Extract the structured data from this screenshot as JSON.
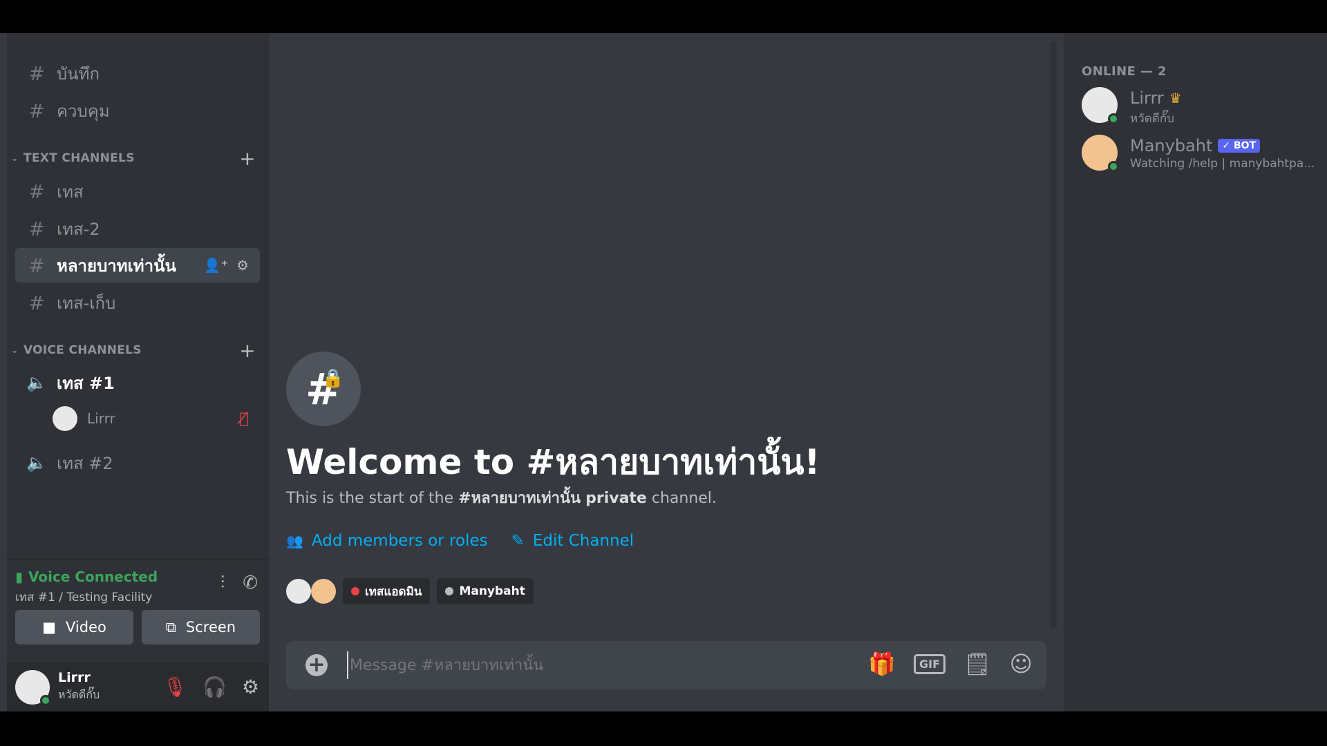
{
  "sidebar": {
    "top_channels": [
      {
        "name": "บันทึก"
      },
      {
        "name": "ควบคุม"
      }
    ],
    "text_category": "TEXT CHANNELS",
    "text_channels": [
      {
        "name": "เทส"
      },
      {
        "name": "เทส-2"
      },
      {
        "name": "หลายบาทเท่านั้น"
      },
      {
        "name": "เทส-เก็บ"
      }
    ],
    "voice_category": "VOICE CHANNELS",
    "voice_channels": [
      {
        "name": "เทส #1"
      },
      {
        "name": "เทส #2"
      }
    ],
    "voice_users": [
      {
        "name": "Lirrr"
      }
    ]
  },
  "voice_panel": {
    "status": "Voice Connected",
    "location": "เทส #1 / Testing Facility",
    "video_label": "Video",
    "screen_label": "Screen"
  },
  "user": {
    "name": "Lirrr",
    "status": "หวัดดีกั๊บ"
  },
  "main": {
    "welcome_title": "Welcome to #หลายบาทเท่านั้น!",
    "desc_prefix": "This is the start of the ",
    "desc_channel": "#หลายบาทเท่านั้น",
    "desc_private": "private",
    "desc_suffix": " channel.",
    "add_members": "Add members or roles",
    "edit_channel": "Edit Channel",
    "roles": [
      {
        "name": "เทสแอดมิน",
        "color": "#ed4245"
      },
      {
        "name": "Manybaht",
        "color": "#b9bbbe"
      }
    ],
    "composer_placeholder": "Message #หลายบาทเท่านั้น"
  },
  "members": {
    "header": "ONLINE — 2",
    "list": [
      {
        "name": "Lirrr",
        "sub": "หวัดดีกั๊บ"
      },
      {
        "name": "Manybaht",
        "badge": "✓ BOT",
        "sub": "Watching /help | manybahtpa..."
      }
    ]
  },
  "colors": {
    "online": "#3ba55d",
    "link": "#00aff4",
    "bot_badge": "#5865f2"
  }
}
